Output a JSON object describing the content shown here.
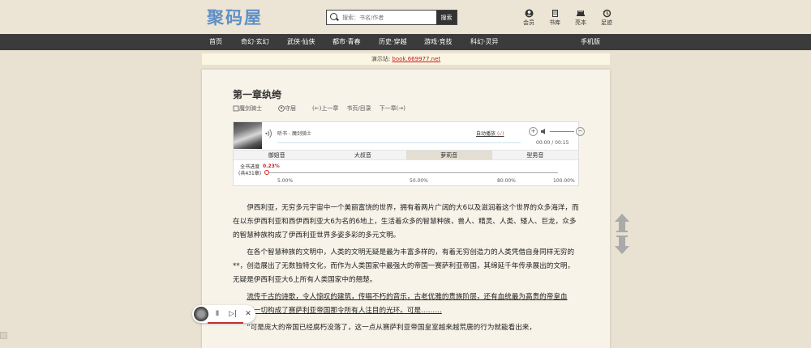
{
  "header": {
    "logo": "聚码屋",
    "search_placeholder": "搜索：书名/作者",
    "search_button": "搜索",
    "icons": [
      {
        "label": "会员",
        "icon": "user-icon"
      },
      {
        "label": "书库",
        "icon": "book-icon"
      },
      {
        "label": "亮本",
        "icon": "hat-icon"
      },
      {
        "label": "足迹",
        "icon": "history-icon"
      }
    ]
  },
  "nav": {
    "items": [
      "首页",
      "奇幻·玄幻",
      "武侠·仙侠",
      "都市·青春",
      "历史·穿越",
      "游戏·竞技",
      "科幻·灵异"
    ],
    "mobile": "手机版"
  },
  "demo": {
    "prefix": "演示站:",
    "link": "book.669977.net"
  },
  "chapter": {
    "title": "第一章纨绔",
    "author": "魔剑骑士",
    "guard": "守层",
    "prev": "(←)上一章",
    "index": "书页/目录",
    "next": "下一章(→)"
  },
  "player": {
    "title": "听书 - 魔剑骑士",
    "autoplay": "自动播放",
    "autoplay_flag": "(√)",
    "minus": "−",
    "plus": "+",
    "time": "00:00 / 00:15",
    "voices": [
      "御姐音",
      "大叔音",
      "萝莉音",
      "型男音"
    ],
    "active_voice": "萝莉音",
    "progress_label_1": "全书进度",
    "progress_label_2": "(共431章)",
    "progress_pct": "0.23%",
    "progress_fraction": 0.0023,
    "ticks": [
      "5.00%",
      "50.00%",
      "80.00%",
      "100.00%"
    ]
  },
  "paragraphs": [
    "伊西利亚，无穷多元宇宙中一个美丽富饶的世界，拥有着两片广阔的大6以及滋润着这个世界的众多海洋，而在以东伊西利亚和西伊西利亚大6为名的6地上，生活着众多的智慧种族，兽人、精灵、人类、矮人、巨龙，众多的智慧种族构成了伊西利亚世界多姿多彩的多元文明。",
    "在各个智慧种族的文明中，人类的文明无疑是最为丰富多样的，有着无穷创造力的人类凭借自身同样无穷的**，创造展出了无数独特文化，而作为人类国家中最强大的帝国一赛萨利亚帝国，其绵延千年传承展出的文明，无疑是伊西利亚大6上所有人类国家中的翘楚。",
    "流传千古的诗歌，令人惊叹的建筑，传唱不朽的音乐，古老优雅的贵族阶层，还有血统最为高贵的帝皇血脉，这一切构成了赛萨利亚帝国那令所有人注目的光环。可是………",
    "“可是庞大的帝国已经腐朽没落了，这一点从赛萨利亚帝国皇室越来越荒唐的行为就能看出来，"
  ],
  "mini_player": {
    "pause": "Ⅱ",
    "next": "▷|",
    "close": "✕"
  }
}
